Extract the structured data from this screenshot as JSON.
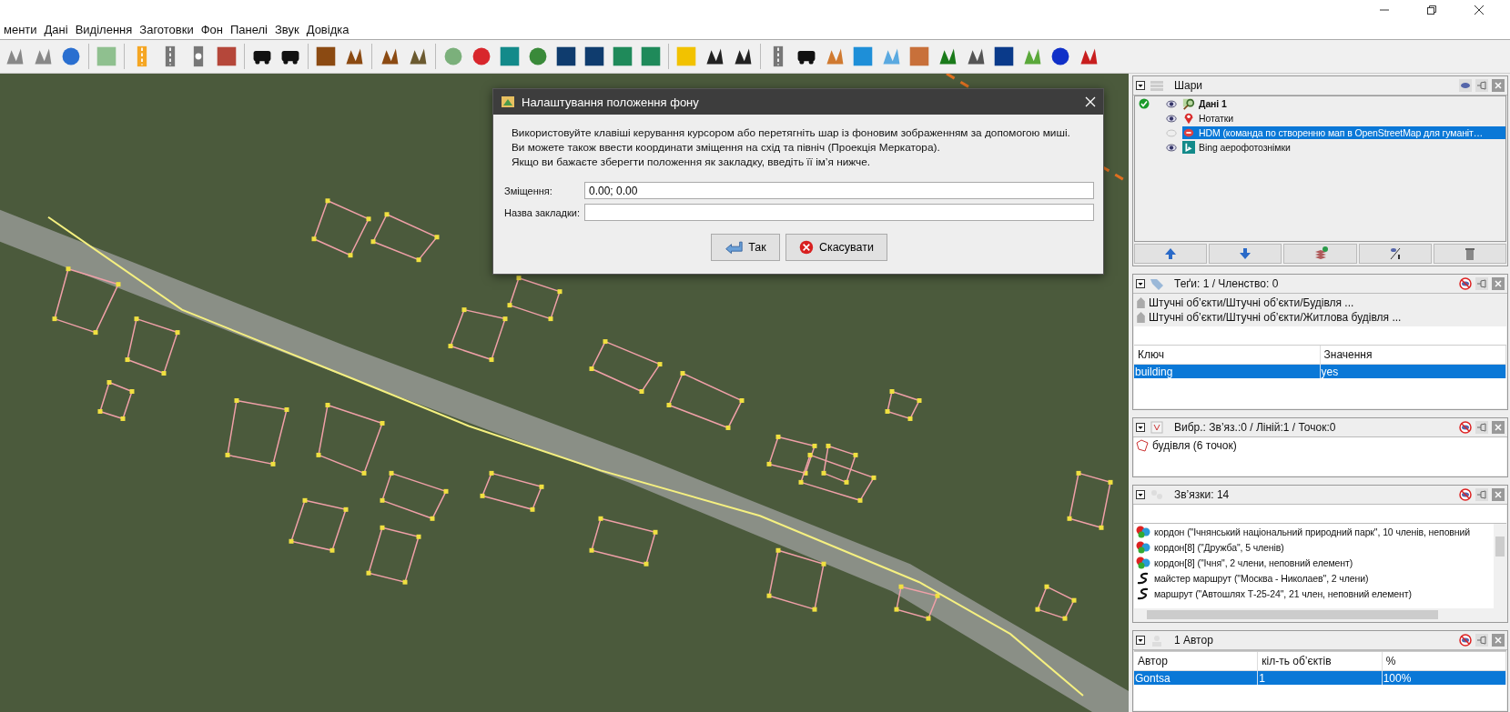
{
  "menu": [
    "менти",
    "Дані",
    "Виділення",
    "Заготовки",
    "Фон",
    "Панелі",
    "Звук",
    "Довідка"
  ],
  "dialog": {
    "title": "Налаштування положення фону",
    "message_lines": [
      "Використовуйте клавіші керування курсором або перетягніть шар із фоновим зображенням за допомогою миші.",
      "Ви можете також ввести координати зміщення на схід та північ (Проекція Меркатора).",
      "Якщо ви бажаєте зберегти положення як закладку, введіть її ім’я нижче."
    ],
    "fields": [
      {
        "label": "Зміщення:",
        "value": "0.00; 0.00"
      },
      {
        "label": "Назва закладки:"
      }
    ],
    "buttons": [
      {
        "label": "Так",
        "kind": "ok"
      },
      {
        "label": "Скасувати",
        "kind": "cancel"
      }
    ]
  },
  "layers_panel": {
    "title": "Шари",
    "layers": [
      {
        "name": "Дані 1",
        "kind": "data",
        "active": true,
        "visible": true,
        "selected": false
      },
      {
        "name": "Нотатки",
        "kind": "notes",
        "active": false,
        "visible": true,
        "selected": false
      },
      {
        "name": "HDM (команда по створенню мап в OpenStreetMap для гуманіт…",
        "kind": "hdm",
        "active": false,
        "visible": false,
        "selected": true
      },
      {
        "name": "Bing аерофотознімки",
        "kind": "bing",
        "active": false,
        "visible": true,
        "selected": false
      }
    ]
  },
  "tags_panel": {
    "title": "Теґи: 1 / Членство: 0",
    "presets": [
      "Штучні об’єкти/Штучні об’єкти/Будівля ...",
      "Штучні об’єкти/Штучні об’єкти/Житлова будівля ..."
    ],
    "columns": [
      "Ключ",
      "Значення"
    ],
    "rows": [
      {
        "cells": [
          "building",
          "yes"
        ],
        "selected": true
      }
    ]
  },
  "selection_panel": {
    "title": "Вибр.: Зв’яз.:0 / Ліній:1 / Точок:0",
    "items": [
      "будівля (6 точок)"
    ]
  },
  "relations_panel": {
    "title": "Зв’язки: 14",
    "items": [
      {
        "kind": "boundary",
        "label": "кордон (\"Ічнянський національний природний парк\", 10 членів, неповний"
      },
      {
        "kind": "boundary",
        "label": "кордон[8] (\"Дружба\", 5 членів)"
      },
      {
        "kind": "boundary",
        "label": "кордон[8] (\"Ічня\", 2 члени, неповний елемент)"
      },
      {
        "kind": "route",
        "label": "майстер маршрут (\"Москва - Николаев\", 2 члени)"
      },
      {
        "kind": "route",
        "label": "маршрут (\"Автошлях Т-25-24\", 21 член, неповний елемент)"
      }
    ]
  },
  "authors_panel": {
    "title": "1 Автор",
    "columns": [
      "Автор",
      "кіл-ть об’єктів",
      "%"
    ],
    "rows": [
      {
        "cells": [
          "Gontsa",
          "1",
          "100%"
        ],
        "selected": true
      }
    ]
  }
}
